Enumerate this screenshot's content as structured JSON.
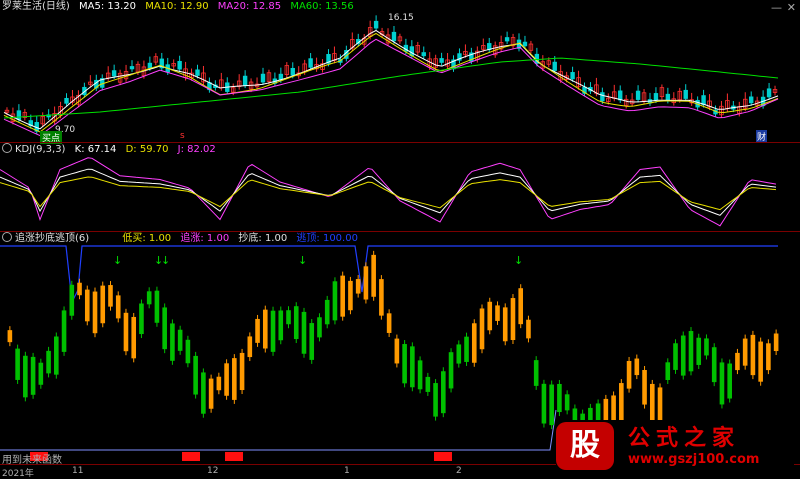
{
  "main": {
    "title": "罗莱生活(日线)",
    "ma": [
      {
        "label": "MA5: 13.20",
        "color": "#ffffff"
      },
      {
        "label": "MA10: 12.90",
        "color": "#e8e000"
      },
      {
        "label": "MA20: 12.85",
        "color": "#ff40ff"
      },
      {
        "label": "MA60: 13.56",
        "color": "#00e000"
      }
    ],
    "high_label": "16.15",
    "low_label": "9.70",
    "buy_badge": "买点",
    "s_marker": "s",
    "fin_marker": "财"
  },
  "kdj": {
    "title": "KDJ(9,3,3)",
    "items": [
      {
        "label": "K: 67.14",
        "color": "#ffffff"
      },
      {
        "label": "D: 59.70",
        "color": "#e8e000"
      },
      {
        "label": "J: 82.02",
        "color": "#ff40ff"
      }
    ]
  },
  "signal": {
    "title": "追涨抄底逃顶(6)",
    "items": [
      {
        "label": "低买: 1.00",
        "color": "#e8e000"
      },
      {
        "label": "追涨: 1.00",
        "color": "#ff40ff"
      },
      {
        "label": "抄底: 1.00",
        "color": "#e0e0e0"
      },
      {
        "label": "逃顶: 100.00",
        "color": "#2040ff"
      }
    ],
    "footer": "用到未来函数"
  },
  "axis": {
    "labels": [
      "2021年",
      "11",
      "12",
      "1",
      "2"
    ]
  },
  "watermark": {
    "stamp": "股",
    "title": "公式之家",
    "url": "www.gszj100.com"
  },
  "colors": {
    "up": "#ff3030",
    "down": "#00d0d0",
    "sep": "#7a0000",
    "green": "#00c000",
    "orange": "#ff9a00"
  }
}
